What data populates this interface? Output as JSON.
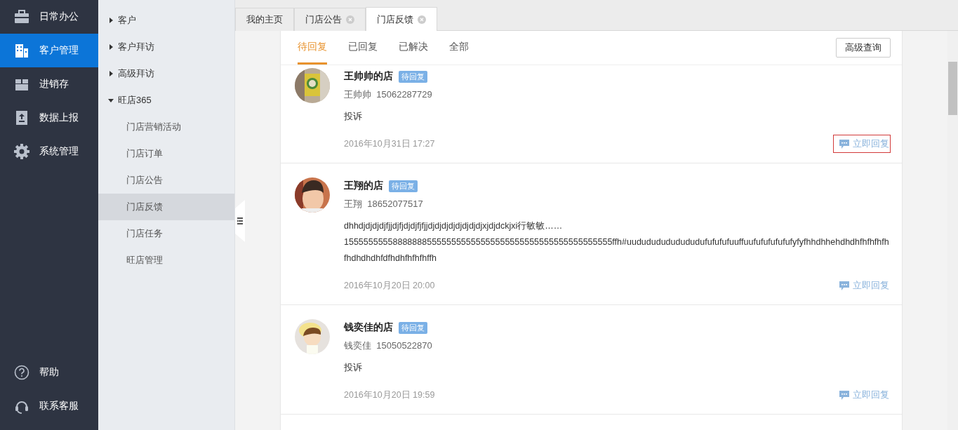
{
  "nav": {
    "items": [
      {
        "label": "日常办公",
        "selected": false
      },
      {
        "label": "客户管理",
        "selected": true
      },
      {
        "label": "进销存",
        "selected": false
      },
      {
        "label": "数据上报",
        "selected": false
      },
      {
        "label": "系统管理",
        "selected": false
      }
    ],
    "bottom": [
      {
        "label": "帮助"
      },
      {
        "label": "联系客服"
      }
    ]
  },
  "submenu": [
    {
      "label": "客户",
      "expanded": false,
      "selected": false
    },
    {
      "label": "客户拜访",
      "expanded": false,
      "selected": false
    },
    {
      "label": "高级拜访",
      "expanded": false,
      "selected": false
    },
    {
      "label": "旺店365",
      "expanded": true,
      "selected": false,
      "children": [
        {
          "label": "门店营销活动",
          "selected": false
        },
        {
          "label": "门店订单",
          "selected": false
        },
        {
          "label": "门店公告",
          "selected": false
        },
        {
          "label": "门店反馈",
          "selected": true
        },
        {
          "label": "门店任务",
          "selected": false
        },
        {
          "label": "旺店管理",
          "selected": false
        }
      ]
    }
  ],
  "tabs": [
    {
      "label": "我的主页",
      "selected": false,
      "closable": false
    },
    {
      "label": "门店公告",
      "selected": false,
      "closable": true
    },
    {
      "label": "门店反馈",
      "selected": true,
      "closable": true
    }
  ],
  "filters": [
    {
      "label": "待回复",
      "selected": true
    },
    {
      "label": "已回复",
      "selected": false
    },
    {
      "label": "已解决",
      "selected": false
    },
    {
      "label": "全部",
      "selected": false
    }
  ],
  "advanced_search": "高级查询",
  "feedback": [
    {
      "store": "王帅帅的店",
      "status": "待回复",
      "contact": "王帅帅",
      "phone": "15062287729",
      "content": "投诉",
      "time": "2016年10月31日 17:27",
      "reply": "立即回复",
      "highlighted": true
    },
    {
      "store": "王翔的店",
      "status": "待回复",
      "contact": "王翔",
      "phone": "18652077517",
      "content": "dhhdjdjdjdjfjjdjfjdjdjfjfjjdjdjdjdjdjdjdjdjxjdjdckjxi行敏敏……\n1555555555888888855555555555555555555555555555555555555ffh#uudududududududufufufufuuffuufufufufufufyfyfhhdhhehdhdhfhfhfhfhfhdhdhdhfdfhdhfhfhfhffh",
      "time": "2016年10月20日 20:00",
      "reply": "立即回复",
      "highlighted": false
    },
    {
      "store": "钱奕佳的店",
      "status": "待回复",
      "contact": "钱奕佳",
      "phone": "15050522870",
      "content": "投诉",
      "time": "2016年10月20日 19:59",
      "reply": "立即回复",
      "highlighted": false
    }
  ]
}
